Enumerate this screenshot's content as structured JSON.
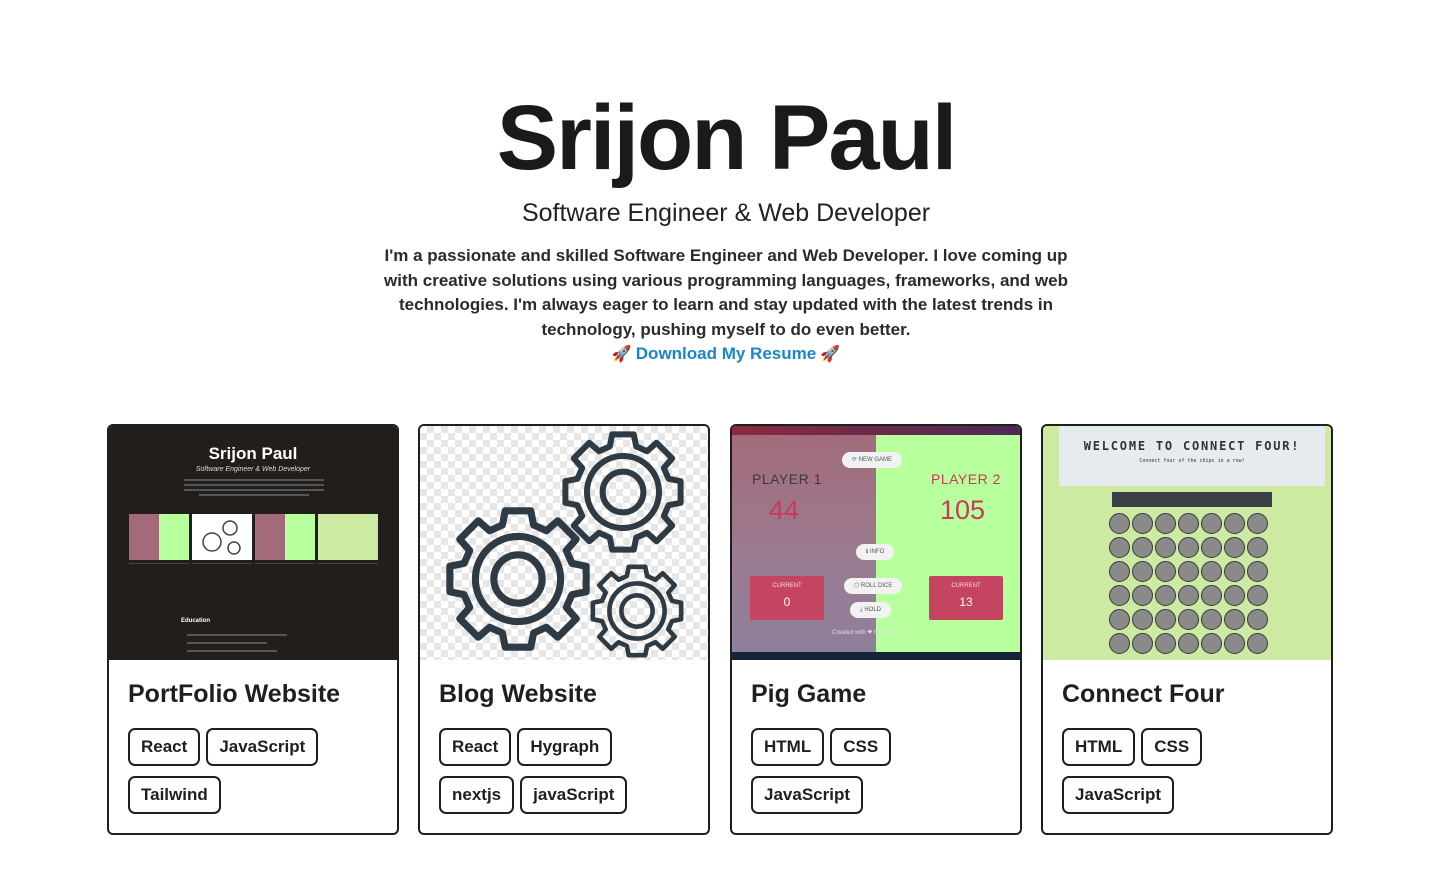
{
  "header": {
    "name": "Srijon Paul",
    "subtitle": "Software Engineer & Web Developer",
    "bio": "I'm a passionate and skilled Software Engineer and Web Developer. I love coming up with creative solutions using various programming languages, frameworks, and web technologies. I'm always eager to learn and stay updated with the latest trends in technology, pushing myself to do even better.",
    "resume_link": "Download My Resume",
    "rocket_icon": "🚀",
    "link_color": "#1a86c8"
  },
  "projects": [
    {
      "title": "PortFolio Website",
      "tags": [
        "React",
        "JavaScript",
        "Tailwind"
      ],
      "thumb": {
        "name": "Srijon Paul",
        "subtitle": "Software Engineer & Web Developer",
        "section": "Education"
      }
    },
    {
      "title": "Blog Website",
      "tags": [
        "React",
        "Hygraph",
        "nextjs",
        "javaScript"
      ],
      "thumb": {
        "icon": "gears-icon"
      }
    },
    {
      "title": "Pig Game",
      "tags": [
        "HTML",
        "CSS",
        "JavaScript"
      ],
      "thumb": {
        "new_game": "NEW GAME",
        "player1": "PLAYER 1",
        "player2": "PLAYER 2",
        "score1": "44",
        "score2": "105",
        "info": "INFO",
        "roll_dice": "ROLL DICE",
        "hold": "HOLD",
        "current_label": "CURRENT",
        "current1": "0",
        "current2": "13",
        "footer": "Created with ❤ by Srijon"
      }
    },
    {
      "title": "Connect Four",
      "tags": [
        "HTML",
        "CSS",
        "JavaScript"
      ],
      "thumb": {
        "title": "WELCOME TO CONNECT FOUR!",
        "subtitle": "Connect four of the chips in a row!"
      }
    }
  ]
}
